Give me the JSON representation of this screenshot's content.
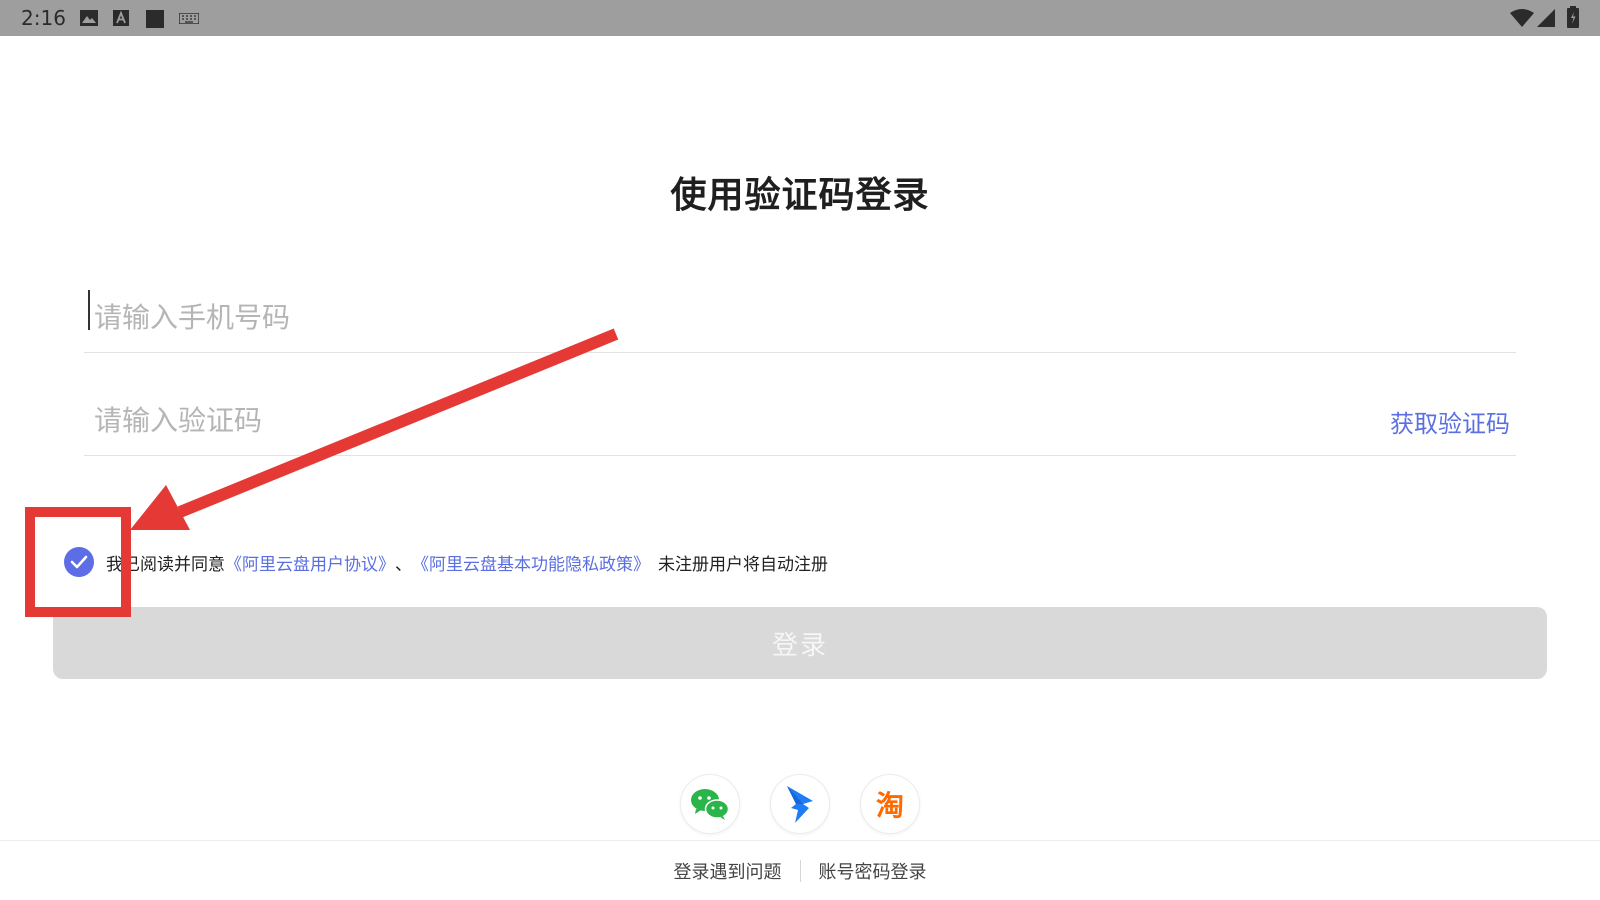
{
  "status_bar": {
    "time": "2:16",
    "left_icons": [
      "image-icon",
      "font-a-icon",
      "square-icon",
      "keyboard-icon"
    ],
    "right_icons": [
      "wifi-icon",
      "signal-icon",
      "battery-icon"
    ]
  },
  "login": {
    "title": "使用验证码登录",
    "phone_placeholder": "请输入手机号码",
    "code_placeholder": "请输入验证码",
    "get_code_label": "获取验证码",
    "agreement": {
      "checked": true,
      "prefix": "我已阅读并同意",
      "user_agreement": "《阿里云盘用户协议》",
      "separator": "、",
      "privacy_policy": "《阿里云盘基本功能隐私政策》",
      "suffix": "未注册用户将自动注册"
    },
    "login_button_label": "登录"
  },
  "social_login": {
    "items": [
      "wechat-icon",
      "dingtalk-icon",
      "taobao-icon"
    ],
    "taobao_char": "淘"
  },
  "footer": {
    "trouble_label": "登录遇到问题",
    "password_login_label": "账号密码登录"
  },
  "colors": {
    "accent": "#5b6fe0",
    "annotation_red": "#e53935",
    "disabled_button": "#d9d9d9"
  }
}
